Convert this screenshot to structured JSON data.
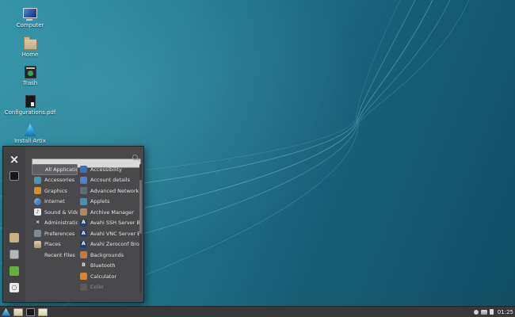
{
  "desktop": {
    "icons": [
      {
        "label": "Computer",
        "name": "desktop-icon-computer",
        "icon": "computer-icon",
        "cls": "art-computer"
      },
      {
        "label": "Home",
        "name": "desktop-icon-home",
        "icon": "home-folder-icon",
        "cls": "art-home"
      },
      {
        "label": "Trash",
        "name": "desktop-icon-trash",
        "icon": "trash-icon",
        "cls": "art-trash"
      },
      {
        "label": "Configurations.pdf",
        "name": "desktop-icon-configurations-pdf",
        "icon": "pdf-file-icon",
        "cls": "art-pdf"
      },
      {
        "label": "Install Artix",
        "name": "desktop-icon-install-artix",
        "icon": "artix-installer-icon",
        "cls": "art-artix"
      }
    ]
  },
  "menu": {
    "search": {
      "placeholder": "",
      "value": ""
    },
    "categories": [
      {
        "label": "All Applications",
        "selected": true,
        "color": "transparent",
        "glyph": ""
      },
      {
        "label": "Accessories",
        "color": "#3f9bb0",
        "glyph": ""
      },
      {
        "label": "Graphics",
        "color": "#d98f2e",
        "glyph": ""
      },
      {
        "label": "Internet",
        "color": "#3f86c4",
        "glyph": "",
        "cls": "round"
      },
      {
        "label": "Sound & Video",
        "color": "#e8e8e8",
        "glyph": "♪",
        "glyph_color": "#26357e"
      },
      {
        "label": "Administration",
        "color": "transparent",
        "glyph": "×",
        "glyph_color": "#ececec"
      },
      {
        "label": "Preferences",
        "color": "#7e8b96",
        "glyph": ""
      },
      {
        "label": "Places",
        "color": "#c9b183",
        "glyph": "",
        "cls": "folder"
      },
      {
        "label": "Recent Files",
        "color": "transparent",
        "glyph": "",
        "cls": "noicon"
      }
    ],
    "apps": [
      {
        "label": "Accessibility",
        "color": "#3b6fc4",
        "glyph": ""
      },
      {
        "label": "Account details",
        "color": "#4f81d6",
        "glyph": ""
      },
      {
        "label": "Advanced Network Configura...",
        "color": "#5d6e78",
        "glyph": ""
      },
      {
        "label": "Applets",
        "color": "#4a90a8",
        "glyph": ""
      },
      {
        "label": "Archive Manager",
        "color": "#b08a5a",
        "glyph": ""
      },
      {
        "label": "Avahi SSH Server Browser",
        "color": "#24406e",
        "glyph": "A"
      },
      {
        "label": "Avahi VNC Server Browser",
        "color": "#24406e",
        "glyph": "A"
      },
      {
        "label": "Avahi Zeroconf Browser",
        "color": "#24406e",
        "glyph": "A"
      },
      {
        "label": "Backgrounds",
        "color": "#c7793a",
        "glyph": ""
      },
      {
        "label": "Bluetooth",
        "color": "transparent",
        "glyph": "B",
        "glyph_color": "#f0f0f0"
      },
      {
        "label": "Calculator",
        "color": "#d9832e",
        "glyph": ""
      },
      {
        "label": "Color",
        "color": "#6f6f6f",
        "glyph": "",
        "disabled": true
      }
    ],
    "side_buttons": [
      {
        "name": "settings-button",
        "cls": "settings",
        "color": "transparent",
        "glyph": "×",
        "glyph_color": "#ececec"
      },
      {
        "name": "terminal-button",
        "cls": "terminal",
        "color": "#17171a",
        "glyph": ""
      },
      {
        "name": "file-manager-button",
        "cls": "file-manager",
        "color": "#c9b183",
        "glyph": ""
      },
      {
        "name": "lock-screen-button",
        "cls": "lock-screen",
        "color": "#b3b7ba",
        "glyph": ""
      },
      {
        "name": "log-out-button",
        "cls": "log-out",
        "color": "#68b03e",
        "glyph": ""
      },
      {
        "name": "shut-down-button",
        "cls": "shut-down",
        "color": "#e9e9e9",
        "glyph": "○"
      }
    ]
  },
  "taskbar": {
    "launchers": [
      {
        "name": "app-menu-button",
        "cls": "tb-artix"
      },
      {
        "name": "file-manager-launcher",
        "cls": "tb-folder"
      },
      {
        "name": "terminal-launcher",
        "cls": "tb-terminal"
      },
      {
        "name": "files-launcher",
        "cls": "tb-folder2"
      }
    ],
    "tray": [
      {
        "name": "volume-icon",
        "cls": "tr-volume"
      },
      {
        "name": "network-icon",
        "cls": "tr-network"
      },
      {
        "name": "power-manager-icon",
        "cls": "tr-battery"
      }
    ],
    "clock": "01:25"
  },
  "colors": {
    "wallpaper_light": "#2f90a5",
    "wallpaper_dark": "#114e64",
    "panel": "#49494b",
    "taskbar": "#38383a",
    "selection": "#5f5f62",
    "artix_blue": "#2e9fd8"
  }
}
